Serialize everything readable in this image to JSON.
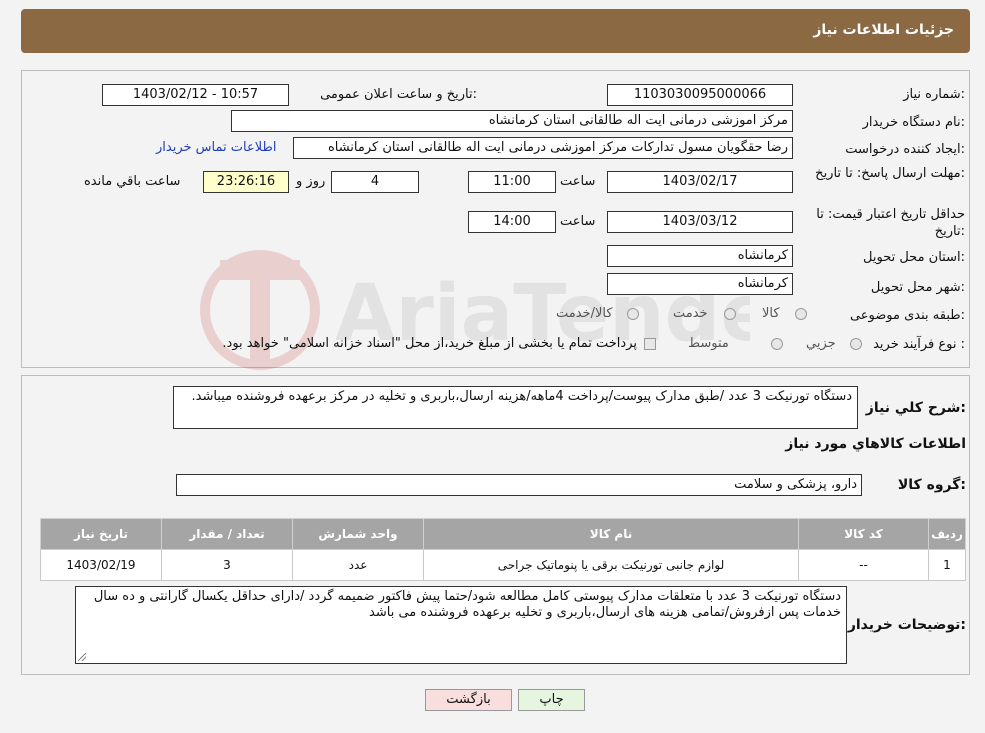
{
  "header": {
    "title": "جزئیات اطلاعات نیاز"
  },
  "labels": {
    "need_number": "شماره نیاز:",
    "announce_datetime": "تاریخ و ساعت اعلان عمومی:",
    "buyer_org": "نام دستگاه خریدار:",
    "requester": "ایجاد کننده درخواست:",
    "reply_deadline": "مهلت ارسال پاسخ: تا تاریخ:",
    "price_validity": "حداقل تاریخ اعتبار قیمت: تا تاریخ:",
    "time_word": "ساعت",
    "day_and": "روز و",
    "remaining": "ساعت باقي مانده",
    "province": "استان محل تحویل:",
    "city": "شهر محل تحویل:",
    "category": "طبقه بندی موضوعی:",
    "process_type": "نوع فرآیند خرید :",
    "description": "شرح کلي نياز:",
    "goods_info": "اطلاعات کالاهاي مورد نياز",
    "goods_group": "گروه کالا:",
    "buyer_notes": "توضیحات خریدار:"
  },
  "values": {
    "need_number": "1103030095000066",
    "announce_datetime": "1403/02/12 - 10:57",
    "buyer_org": "مرکز اموزشی درمانی ایت اله طالقانی استان کرمانشاه",
    "requester": "رضا حقگویان مسول تدارکات مرکز اموزشی درمانی ایت اله طالقانی استان کرمانشاه",
    "contact_link": "اطلاعات تماس خریدار",
    "reply_date": "1403/02/17",
    "reply_time": "11:00",
    "reply_days": "4",
    "reply_remaining": "23:26:16",
    "validity_date": "1403/03/12",
    "validity_time": "14:00",
    "province": "کرمانشاه",
    "city": "کرمانشاه"
  },
  "category_options": [
    "کالا",
    "خدمت",
    "کالا/خدمت"
  ],
  "process_options": [
    "جزیي",
    "متوسط"
  ],
  "process_note": "پرداخت تمام یا بخشی از مبلغ خرید،از محل \"اسناد خزانه اسلامی\" خواهد بود.",
  "description": "دستگاه تورنیکت 3 عدد /طبق مدارک پیوست/پرداخت 4ماهه/هزینه ارسال،باربری و تخلیه در مرکز برعهده فروشنده میباشد.",
  "goods_group": "دارو، پزشکی و سلامت",
  "table": {
    "headers": [
      "ردیف",
      "کد کالا",
      "نام کالا",
      "واحد شمارش",
      "تعداد / مقدار",
      "تاریخ نیاز"
    ],
    "rows": [
      [
        "1",
        "--",
        "لوازم جانبی تورنیکت برقی یا پنوماتیک جراحی",
        "عدد",
        "3",
        "1403/02/19"
      ]
    ]
  },
  "buyer_notes": "دستگاه تورنیکت 3 عدد با متعلقات مدارک پیوستی کامل مطالعه شود/حتما پیش فاکتور ضمیمه گردد /دارای حداقل یکسال گارانتی و ده سال خدمات پس ازفروش/تمامی هزینه های ارسال،باربری و تخلیه برعهده فروشنده می باشد",
  "buttons": {
    "print": "چاپ",
    "back": "بازگشت"
  },
  "watermark": {
    "text": "AriaTender.neT"
  }
}
